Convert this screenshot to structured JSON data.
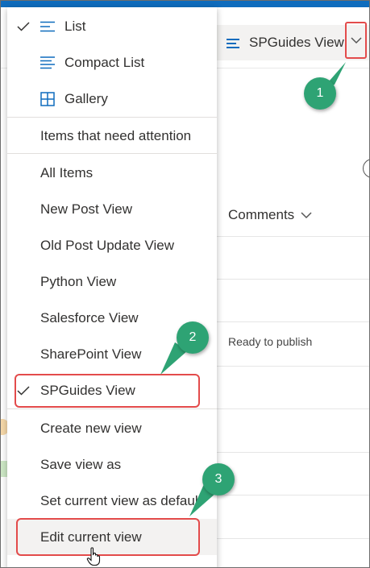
{
  "header": {
    "current_view_label": "SPGuides View"
  },
  "list": {
    "column_header": "Comments",
    "cell_value": "Ready to publish"
  },
  "menu": {
    "layout_options": [
      {
        "label": "List",
        "checked": true,
        "icon": "list-icon"
      },
      {
        "label": "Compact List",
        "checked": false,
        "icon": "compact-list-icon"
      },
      {
        "label": "Gallery",
        "checked": false,
        "icon": "gallery-icon"
      }
    ],
    "attention_label": "Items that need attention",
    "views": [
      {
        "label": "All Items"
      },
      {
        "label": "New Post View"
      },
      {
        "label": "Old Post Update View"
      },
      {
        "label": "Python View"
      },
      {
        "label": "Salesforce View"
      },
      {
        "label": "SharePoint View"
      },
      {
        "label": "SPGuides View",
        "checked": true
      }
    ],
    "actions": [
      {
        "label": "Create new view"
      },
      {
        "label": "Save view as"
      },
      {
        "label": "Set current view as defaul"
      },
      {
        "label": "Edit current view"
      }
    ]
  },
  "callouts": [
    "1",
    "2",
    "3"
  ],
  "colors": {
    "accent": "#0f6cbd",
    "highlight": "#e34b4b",
    "callout": "#2ea374"
  }
}
